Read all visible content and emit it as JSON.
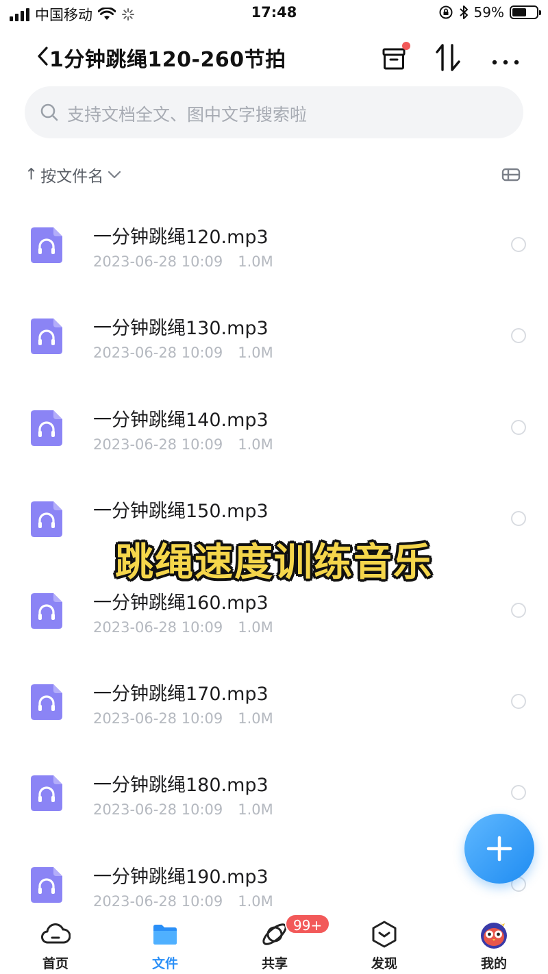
{
  "status_bar": {
    "carrier": "中国移动",
    "time": "17:48",
    "battery_percent": "59%",
    "battery_level": 0.59
  },
  "header": {
    "title": "1分钟跳绳120-260节拍",
    "icons": [
      "back-chevron-icon",
      "archive-box-icon",
      "transfer-icon",
      "more-icon"
    ],
    "notification_dot_color": "#f25959"
  },
  "search": {
    "placeholder": "支持文档全文、图中文字搜索啦"
  },
  "sort": {
    "arrow": "↑",
    "label": "按文件名"
  },
  "files": [
    {
      "name": "一分钟跳绳120.mp3",
      "date": "2023-06-28 10:09",
      "size": "1.0M"
    },
    {
      "name": "一分钟跳绳130.mp3",
      "date": "2023-06-28 10:09",
      "size": "1.0M"
    },
    {
      "name": "一分钟跳绳140.mp3",
      "date": "2023-06-28 10:09",
      "size": "1.0M"
    },
    {
      "name": "一分钟跳绳150.mp3",
      "date": "",
      "size": ""
    },
    {
      "name": "一分钟跳绳160.mp3",
      "date": "2023-06-28 10:09",
      "size": "1.0M"
    },
    {
      "name": "一分钟跳绳170.mp3",
      "date": "2023-06-28 10:09",
      "size": "1.0M"
    },
    {
      "name": "一分钟跳绳180.mp3",
      "date": "2023-06-28 10:09",
      "size": "1.0M"
    },
    {
      "name": "一分钟跳绳190.mp3",
      "date": "2023-06-28 10:09",
      "size": "1.0M"
    }
  ],
  "overlay_caption": "跳绳速度训练音乐",
  "bottom_nav": [
    {
      "label": "首页",
      "icon": "cloud-icon",
      "active": false
    },
    {
      "label": "文件",
      "icon": "folder-icon",
      "active": true
    },
    {
      "label": "共享",
      "icon": "share-orbit-icon",
      "active": false,
      "badge": "99+"
    },
    {
      "label": "发现",
      "icon": "discover-icon",
      "active": false
    },
    {
      "label": "我的",
      "icon": "avatar-icon",
      "active": false
    }
  ],
  "colors": {
    "accent": "#2a8ff7",
    "file_icon": "#8b84f5",
    "caption_fill": "#f5d64b",
    "badge": "#f25959"
  }
}
